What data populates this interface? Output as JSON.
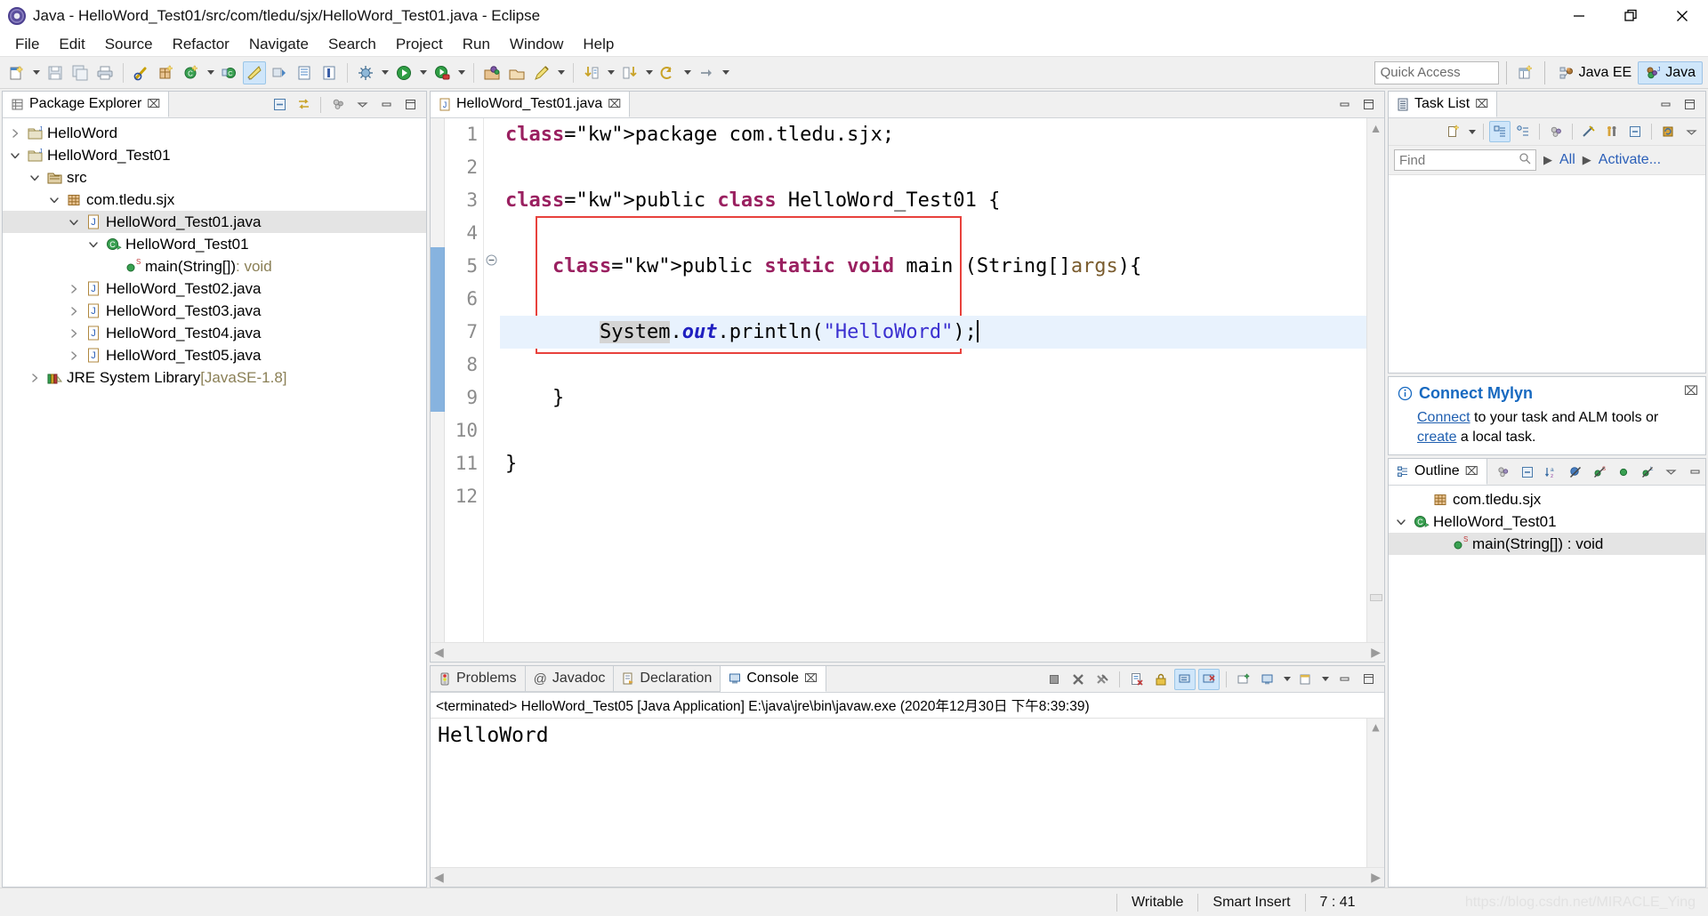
{
  "window": {
    "title": "Java - HelloWord_Test01/src/com/tledu/sjx/HelloWord_Test01.java - Eclipse",
    "minimize_label": "—",
    "maximize_label": "❐",
    "close_label": "✕"
  },
  "menu": {
    "items": [
      "File",
      "Edit",
      "Source",
      "Refactor",
      "Navigate",
      "Search",
      "Project",
      "Run",
      "Window",
      "Help"
    ]
  },
  "toolbar": {
    "quick_access_placeholder": "Quick Access",
    "perspectives": [
      {
        "label": "Java EE",
        "icon": "java-ee-perspective-icon",
        "active": false
      },
      {
        "label": "Java",
        "icon": "java-perspective-icon",
        "active": true
      }
    ],
    "open_perspective_icon": "open-perspective-icon",
    "buttons": [
      "new-wizard-icon",
      "save-icon",
      "save-all-icon",
      "print-icon",
      "toggle-mark-occurrences-icon",
      "new-java-package-icon",
      "new-java-class-icon",
      "new-annotation-icon",
      "open-type-icon",
      "search-icon",
      "next-annotation-icon",
      "previous-annotation-icon",
      "debug-icon",
      "run-icon",
      "run-coverage-icon",
      "open-external-tools-icon",
      "skip-breakpoints-icon",
      "pin-editor-icon",
      "next-edit-location-icon",
      "back-icon",
      "forward-icon"
    ]
  },
  "package_explorer": {
    "tab_label": "Package Explorer",
    "tab_icon": "package-explorer-icon",
    "view_buttons": [
      "collapse-all-icon",
      "link-with-editor-icon",
      "view-menu-icon",
      "minimize-icon",
      "maximize-icon"
    ],
    "tree": [
      {
        "label": "HelloWord",
        "icon": "project-icon",
        "twist": "collapsed",
        "indent": 1,
        "selected": false
      },
      {
        "label": "HelloWord_Test01",
        "icon": "project-icon",
        "twist": "expanded",
        "indent": 1,
        "selected": false
      },
      {
        "label": "src",
        "icon": "source-folder-icon",
        "twist": "expanded",
        "indent": 2,
        "selected": false
      },
      {
        "label": "com.tledu.sjx",
        "icon": "package-icon",
        "twist": "expanded",
        "indent": 3,
        "selected": false
      },
      {
        "label": "HelloWord_Test01.java",
        "icon": "java-file-icon",
        "twist": "expanded",
        "indent": 4,
        "selected": true
      },
      {
        "label": "HelloWord_Test01",
        "icon": "java-class-icon",
        "twist": "expanded",
        "indent": 5,
        "selected": false
      },
      {
        "label": "main(String[])",
        "suffix": " : void",
        "icon": "method-static-icon",
        "twist": "none",
        "indent": 6,
        "selected": false
      },
      {
        "label": "HelloWord_Test02.java",
        "icon": "java-file-icon",
        "twist": "collapsed",
        "indent": 4,
        "selected": false
      },
      {
        "label": "HelloWord_Test03.java",
        "icon": "java-file-icon",
        "twist": "collapsed",
        "indent": 4,
        "selected": false
      },
      {
        "label": "HelloWord_Test04.java",
        "icon": "java-file-icon",
        "twist": "collapsed",
        "indent": 4,
        "selected": false
      },
      {
        "label": "HelloWord_Test05.java",
        "icon": "java-file-icon",
        "twist": "collapsed",
        "indent": 4,
        "selected": false
      },
      {
        "label": "JRE System Library",
        "suffix": " [JavaSE-1.8]",
        "icon": "library-icon",
        "twist": "collapsed",
        "indent": 2,
        "selected": false
      }
    ]
  },
  "editor": {
    "tab_label": "HelloWord_Test01.java",
    "tab_icon": "java-file-icon",
    "close_label": "⌧",
    "minimize_label": "❐",
    "maximize_label": "❑",
    "line_numbers": [
      "1",
      "2",
      "3",
      "4",
      "5",
      "6",
      "7",
      "8",
      "9",
      "10",
      "11",
      "12"
    ],
    "current_line": 7,
    "lines": [
      "package com.tledu.sjx;",
      "",
      "public class HelloWord_Test01 {",
      "",
      "    public static void main (String[]args){",
      "",
      "        System.out.println(\"HelloWord\");",
      "",
      "    }",
      "",
      "}",
      ""
    ],
    "string_literal": "\"HelloWord\"",
    "highlighted_token": "System",
    "annotation_box_color": "#e8413c"
  },
  "bottom_panel": {
    "tabs": [
      {
        "label": "Problems",
        "icon": "problems-icon",
        "active": false
      },
      {
        "label": "Javadoc",
        "icon": "javadoc-icon",
        "active": false
      },
      {
        "label": "Declaration",
        "icon": "declaration-icon",
        "active": false
      },
      {
        "label": "Console",
        "icon": "console-icon",
        "active": true
      }
    ],
    "close_label": "⌧",
    "console_header": "<terminated> HelloWord_Test05 [Java Application] E:\\java\\jre\\bin\\javaw.exe (2020年12月30日 下午8:39:39)",
    "console_output": "HelloWord",
    "view_buttons": [
      "terminate-icon",
      "remove-launch-icon",
      "remove-all-launches-icon",
      "clear-console-icon",
      "scroll-lock-icon",
      "show-console-on-output-icon",
      "show-console-on-error-icon",
      "pin-console-icon",
      "display-selected-console-icon",
      "open-console-icon",
      "view-menu-icon",
      "minimize-icon",
      "maximize-icon"
    ]
  },
  "task_list": {
    "tab_label": "Task List",
    "tab_icon": "task-list-icon",
    "find_placeholder": "Find",
    "find_value": "",
    "filter_all": "All",
    "filter_activate": "Activate...",
    "view_buttons": [
      "new-task-icon",
      "categorized-presentation-icon",
      "scheduled-presentation-icon",
      "synchronize-icon",
      "focus-on-workweek-icon",
      "show-all-tasks-icon",
      "collapse-all-icon",
      "restore-tasks-icon",
      "view-menu-icon",
      "minimize-icon",
      "maximize-icon"
    ]
  },
  "mylyn": {
    "title": "Connect Mylyn",
    "icon": "info-icon",
    "link_connect": "Connect",
    "text_middle": " to your task and ALM tools or ",
    "link_create": "create",
    "text_end": " a local task.",
    "close_label": "⌧"
  },
  "outline": {
    "tab_label": "Outline",
    "tab_icon": "outline-icon",
    "view_buttons": [
      "sort-icon",
      "collapse-all-icon",
      "sort-alpha-icon",
      "hide-fields-icon",
      "hide-static-icon",
      "hide-nonpublic-icon",
      "hide-local-types-icon",
      "view-menu-icon",
      "minimize-icon",
      "maximize-icon"
    ],
    "tree": [
      {
        "label": "com.tledu.sjx",
        "icon": "package-icon",
        "twist": "none",
        "indent": 2,
        "selected": false
      },
      {
        "label": "HelloWord_Test01",
        "icon": "java-class-icon",
        "twist": "expanded",
        "indent": 1,
        "selected": false
      },
      {
        "label": "main(String[]) : void",
        "icon": "method-static-icon",
        "twist": "none",
        "indent": 3,
        "selected": true
      }
    ]
  },
  "status_bar": {
    "writable": "Writable",
    "insert_mode": "Smart Insert",
    "cursor_position": "7 : 41",
    "watermark": "https://blog.csdn.net/MIRACLE_Ying"
  }
}
